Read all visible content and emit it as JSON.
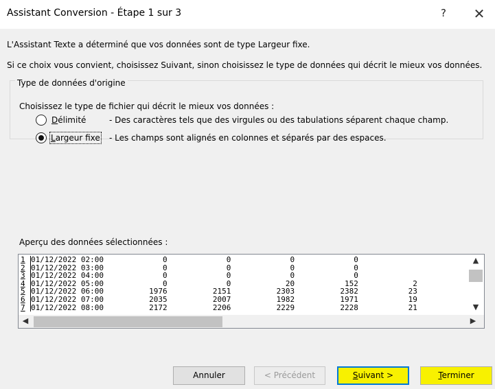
{
  "window": {
    "title": "Assistant Conversion - Étape 1 sur 3",
    "help_label": "?",
    "close_label": "✕"
  },
  "intro": {
    "line1": "L'Assistant Texte a déterminé que vos données sont de type Largeur fixe.",
    "line2": "Si ce choix vous convient, choisissez Suivant, sinon choisissez le type de données qui décrit le mieux vos données."
  },
  "group": {
    "legend": "Type de données d'origine",
    "prompt": "Choisissez le type de fichier qui décrit le mieux vos données :",
    "options": [
      {
        "label_hotkey": "D",
        "label_rest": "élimité",
        "description": "- Des caractères tels que des virgules ou des tabulations séparent chaque champ.",
        "selected": false
      },
      {
        "label_hotkey": "L",
        "label_rest": "argeur fixe",
        "description": "- Les champs sont alignés en colonnes et séparés par des espaces.",
        "selected": true
      }
    ]
  },
  "preview": {
    "label": "Aperçu des données sélectionnées :",
    "rows": [
      {
        "num": "1",
        "text": "01/12/2022 02:00             0             0             0             0             "
      },
      {
        "num": "2",
        "text": "01/12/2022 03:00             0             0             0             0             "
      },
      {
        "num": "3",
        "text": "01/12/2022 04:00             0             0             0             0             "
      },
      {
        "num": "4",
        "text": "01/12/2022 05:00             0             0            20           152            2"
      },
      {
        "num": "5",
        "text": "01/12/2022 06:00          1976          2151          2303          2382           23"
      },
      {
        "num": "6",
        "text": "01/12/2022 07:00          2035          2007          1982          1971           19"
      },
      {
        "num": "7",
        "text": "01/12/2022 08:00          2172          2206          2229          2228           21"
      }
    ]
  },
  "buttons": {
    "cancel": "Annuler",
    "previous": "< Précédent",
    "next_hotkey": "S",
    "next_rest": "uivant >",
    "finish_hotkey": "T",
    "finish_rest": "erminer"
  }
}
